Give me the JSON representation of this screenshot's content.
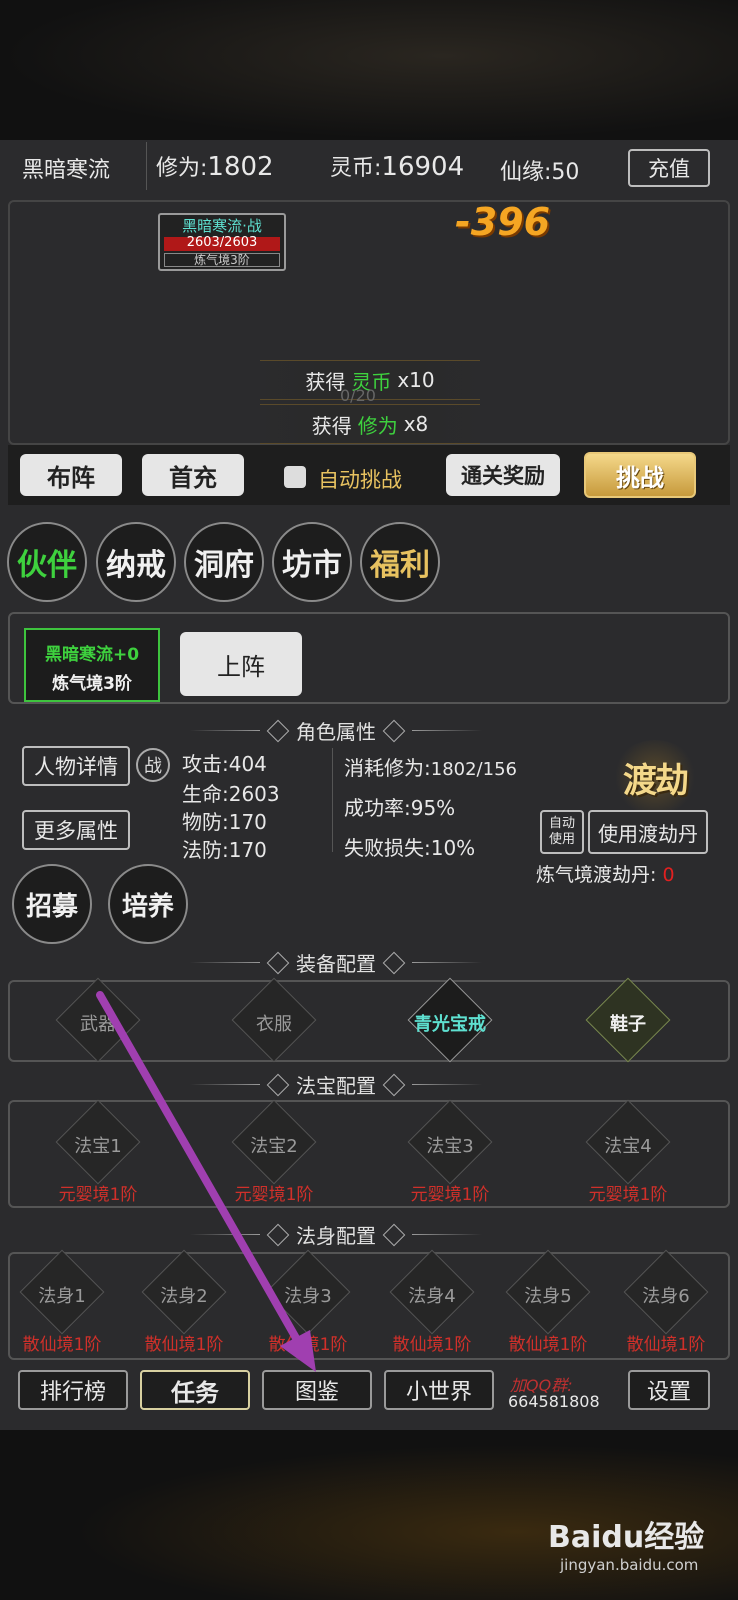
{
  "topbar": {
    "player_name": "黑暗寒流",
    "cultivation_label": "修为:",
    "cultivation_value": "1802",
    "coins_label": "灵币:",
    "coins_value": "16904",
    "fate_label": "仙缘:",
    "fate_value": "50",
    "recharge": "充值"
  },
  "battle": {
    "enemy_name": "黑暗寒流·战",
    "enemy_hp": "2603/2603",
    "enemy_hp_fraction": 1.0,
    "enemy_realm": "炼气境3阶",
    "damage": "-396",
    "progress_text": "0/20",
    "reward1": {
      "prefix": "获得",
      "item": "灵币",
      "amount": "x10"
    },
    "reward2": {
      "prefix": "获得",
      "item": "修为",
      "amount": "x8"
    }
  },
  "actions": {
    "formation": "布阵",
    "first_charge": "首充",
    "auto_challenge": "自动挑战",
    "clear_reward": "通关奖励",
    "challenge": "挑战"
  },
  "tabs": [
    {
      "label": "伙伴",
      "color": "#3ed13e"
    },
    {
      "label": "纳戒",
      "color": "#f0f0f0"
    },
    {
      "label": "洞府",
      "color": "#f0f0f0"
    },
    {
      "label": "坊市",
      "color": "#f0f0f0"
    },
    {
      "label": "福利",
      "color": "#e8c260"
    }
  ],
  "partner": {
    "name": "黑暗寒流+0",
    "realm": "炼气境3阶",
    "deploy": "上阵"
  },
  "attributes": {
    "title": "角色属性",
    "details": "人物详情",
    "battle_badge": "战",
    "more": "更多属性",
    "attack": "攻击:404",
    "life": "生命:2603",
    "phys_def": "物防:170",
    "magic_def": "法防:170",
    "consume": "消耗修为:",
    "consume_value": "1802/156",
    "success": "成功率:95%",
    "fail": "失败损失:10%",
    "tribulation_emblem": "渡劫",
    "auto_use": "自动\n使用",
    "use_pill": "使用渡劫丹",
    "pill_label": "炼气境渡劫丹:",
    "pill_count": "0",
    "recruit": "招募",
    "train": "培养"
  },
  "equipment": {
    "title": "装备配置",
    "slots": [
      {
        "label": "武器",
        "color": "#8a8a8a"
      },
      {
        "label": "衣服",
        "color": "#8a8a8a"
      },
      {
        "label": "青光宝戒",
        "color": "#5ee0d0"
      },
      {
        "label": "鞋子",
        "color": "#f0f0f0"
      }
    ]
  },
  "treasures": {
    "title": "法宝配置",
    "slots": [
      {
        "label": "法宝1",
        "level": "元婴境1阶"
      },
      {
        "label": "法宝2",
        "level": "元婴境1阶"
      },
      {
        "label": "法宝3",
        "level": "元婴境1阶"
      },
      {
        "label": "法宝4",
        "level": "元婴境1阶"
      }
    ]
  },
  "bodies": {
    "title": "法身配置",
    "slots": [
      {
        "label": "法身1",
        "level": "散仙境1阶"
      },
      {
        "label": "法身2",
        "level": "散仙境1阶"
      },
      {
        "label": "法身3",
        "level": "散仙境1阶"
      },
      {
        "label": "法身4",
        "level": "散仙境1阶"
      },
      {
        "label": "法身5",
        "level": "散仙境1阶"
      },
      {
        "label": "法身6",
        "level": "散仙境1阶"
      }
    ]
  },
  "bottom": {
    "ranking": "排行榜",
    "tasks": "任务",
    "atlas": "图鉴",
    "small_world": "小世界",
    "qq_label": "加QQ群:",
    "qq_number": "664581808",
    "settings": "设置"
  },
  "watermark": {
    "brand": "Baidu经验",
    "url": "jingyan.baidu.com"
  }
}
